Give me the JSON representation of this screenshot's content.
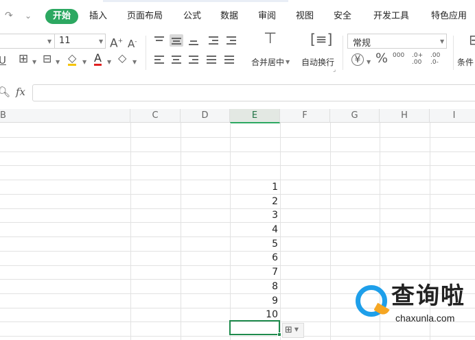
{
  "menubar": {
    "redo_icon": "redo-icon",
    "quick_access_icon": "chevron-down-icon",
    "tabs": [
      {
        "label": "开始",
        "active": true
      },
      {
        "label": "插入"
      },
      {
        "label": "页面布局"
      },
      {
        "label": "公式"
      },
      {
        "label": "数据"
      },
      {
        "label": "审阅"
      },
      {
        "label": "视图"
      },
      {
        "label": "安全"
      },
      {
        "label": "开发工具"
      },
      {
        "label": "特色应用"
      }
    ],
    "accent_color": "#2ca861"
  },
  "ribbon": {
    "font_size": "11",
    "increase_font_glyph": "A",
    "decrease_font_glyph": "A",
    "underline_glyph": "U",
    "font_color_glyph": "A",
    "font_color": "#e02020",
    "merge_center_label": "合并居中",
    "wrap_text_label": "自动换行",
    "number_format": "常规",
    "currency_glyph": "¥",
    "percent_glyph": "%",
    "thousands_glyph": "000",
    "inc_decimal_glyph": ".0+ .00",
    "dec_decimal_glyph": ".00 .0-",
    "conditional_label": "条件"
  },
  "formulabar": {
    "fx_label": "fx",
    "value": ""
  },
  "grid": {
    "columns": [
      "B",
      "C",
      "D",
      "E",
      "F",
      "G",
      "H",
      "I"
    ],
    "selected_column": "E",
    "values": [
      "1",
      "2",
      "3",
      "4",
      "5",
      "6",
      "7",
      "8",
      "9",
      "10"
    ]
  },
  "watermark": {
    "title": "查询啦",
    "url": "chaxunla.com"
  }
}
